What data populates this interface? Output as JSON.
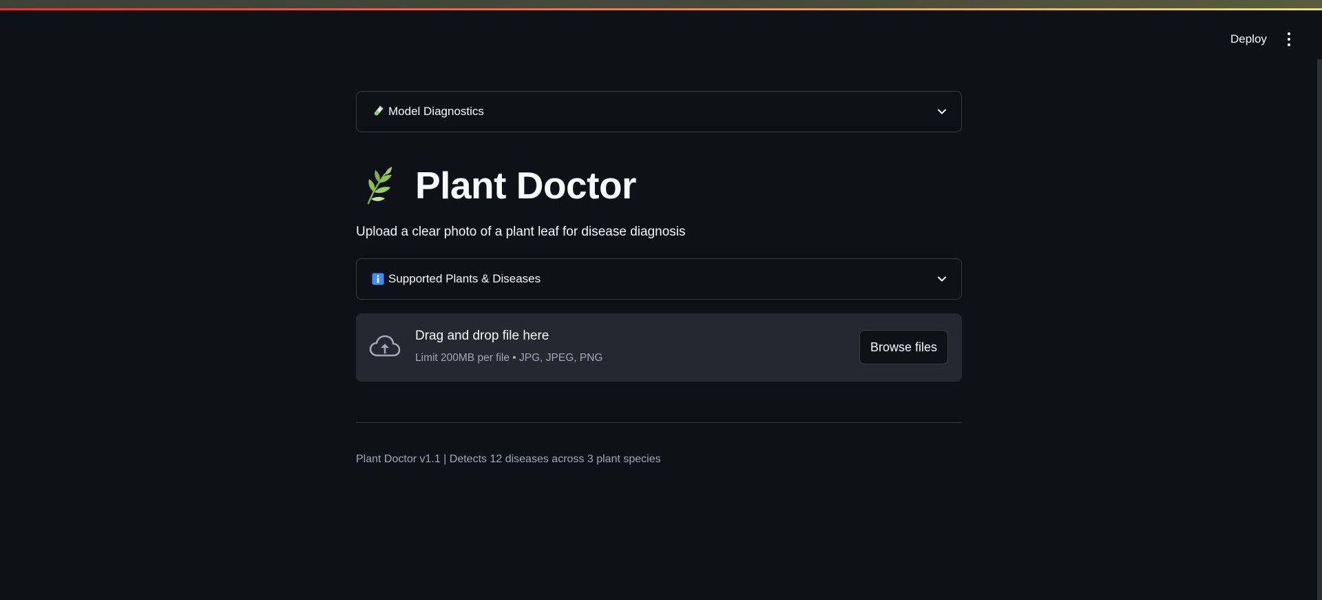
{
  "header": {
    "deploy_label": "Deploy",
    "menu_icon": "more-vertical-icon"
  },
  "diagnostics_expander": {
    "icon": "test-tube-icon",
    "label": "Model Diagnostics",
    "expanded": false
  },
  "title": {
    "icon": "herb-leaf-icon",
    "text": "Plant Doctor"
  },
  "subtitle": "Upload a clear photo of a plant leaf for disease diagnosis",
  "supported_expander": {
    "icon": "info-icon",
    "label": "Supported Plants & Diseases",
    "expanded": false
  },
  "uploader": {
    "icon": "cloud-upload-icon",
    "title": "Drag and drop file here",
    "limit": "Limit 200MB per file • JPG, JPEG, PNG",
    "browse_label": "Browse files"
  },
  "footer": {
    "text": "Plant Doctor v1.1 | Detects 12 diseases across 3 plant species"
  },
  "colors": {
    "background": "#0e1117",
    "uploader_bg": "#262730",
    "border": "#3a3d46",
    "text": "#fafafa",
    "muted_text": "#a3a8b8",
    "accent_red": "#ff4b4b",
    "accent_yellow": "#e8e66a",
    "leaf_green": "#8bc34a"
  }
}
